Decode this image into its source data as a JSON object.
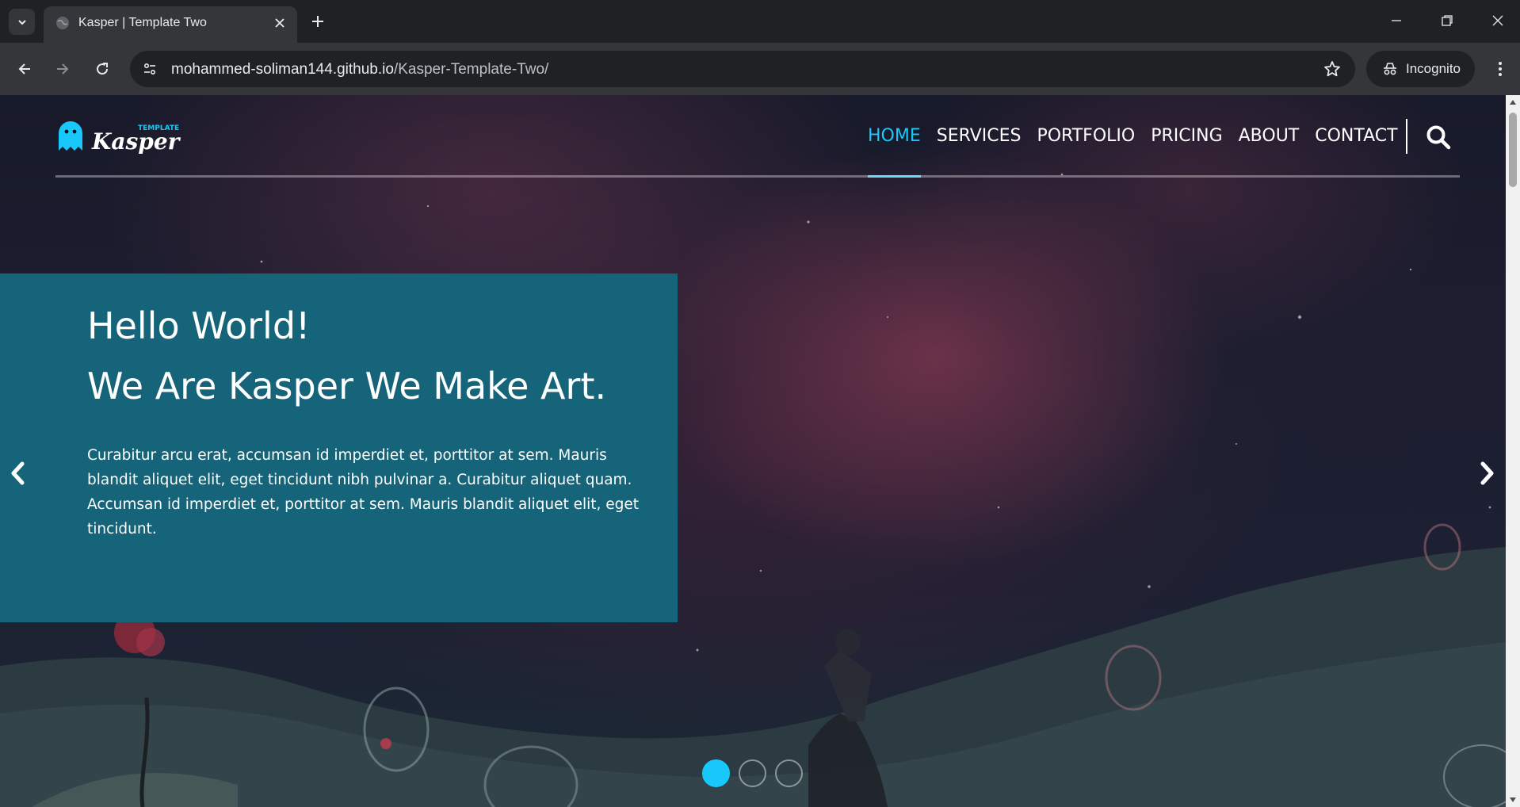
{
  "browser": {
    "tab": {
      "title": "Kasper | Template Two",
      "favicon": "globe-icon"
    },
    "address": {
      "host": "mohammed-soliman144.github.io",
      "path": "/Kasper-Template-Two/"
    },
    "incognito_label": "Incognito",
    "icons": [
      "tab-search-icon",
      "close-icon",
      "plus-icon",
      "minimize-icon",
      "restore-icon",
      "close-window-icon",
      "back-arrow-icon",
      "forward-arrow-icon",
      "reload-icon",
      "site-info-icon",
      "star-icon",
      "incognito-icon",
      "more-vert-icon"
    ]
  },
  "site": {
    "logo": {
      "main": "Kasper",
      "tag": "TEMPLATE",
      "icon": "ghost-icon"
    },
    "nav": [
      {
        "label": "HOME",
        "active": true
      },
      {
        "label": "SERVICES",
        "active": false
      },
      {
        "label": "PORTFOLIO",
        "active": false
      },
      {
        "label": "PRICING",
        "active": false
      },
      {
        "label": "ABOUT",
        "active": false
      },
      {
        "label": "CONTACT",
        "active": false
      }
    ],
    "search_icon": "search-icon",
    "hero": {
      "title_line1": "Hello World!",
      "title_line2": "We Are Kasper We Make Art.",
      "text": "Curabitur arcu erat, accumsan id imperdiet et, porttitor at sem. Mauris blandit aliquet elit, eget tincidunt nibh pulvinar a. Curabitur aliquet quam. Accumsan id imperdiet et, porttitor at sem. Mauris blandit aliquet elit, eget tincidunt."
    },
    "slider": {
      "slide_count": 3,
      "active_slide": 1
    }
  },
  "colors": {
    "accent": "#19c8fa",
    "box": "#166479",
    "chrome_dark": "#202124",
    "chrome_mid": "#35363a"
  }
}
